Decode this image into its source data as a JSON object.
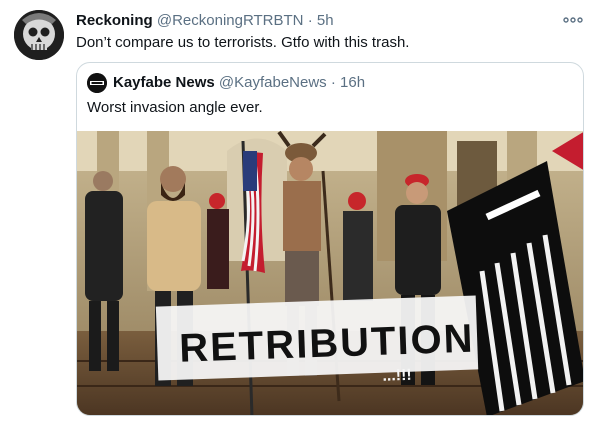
{
  "tweet": {
    "author_name": "Reckoning",
    "author_handle": "@ReckoningRTRBTN",
    "separator": "·",
    "time": "5h",
    "text": "Don’t compare us to terrorists. Gtfo with this trash.",
    "avatar_icon": "skull-avatar",
    "more_icon": "more-dots-icon"
  },
  "quote": {
    "author_name": "Kayfabe News",
    "author_handle": "@KayfabeNews",
    "separator": "·",
    "time": "16h",
    "text": "Worst invasion angle ever.",
    "avatar_label": "Kayfabe",
    "media": {
      "overlay_text": "RETRIBUTION",
      "overlay_suffix": "...!!!",
      "description_icons": [
        "flag-icon",
        "banner-icon"
      ]
    }
  },
  "colors": {
    "name": "#0f1419",
    "muted": "#5b7083",
    "border": "#cfd9de",
    "background": "#ffffff"
  }
}
